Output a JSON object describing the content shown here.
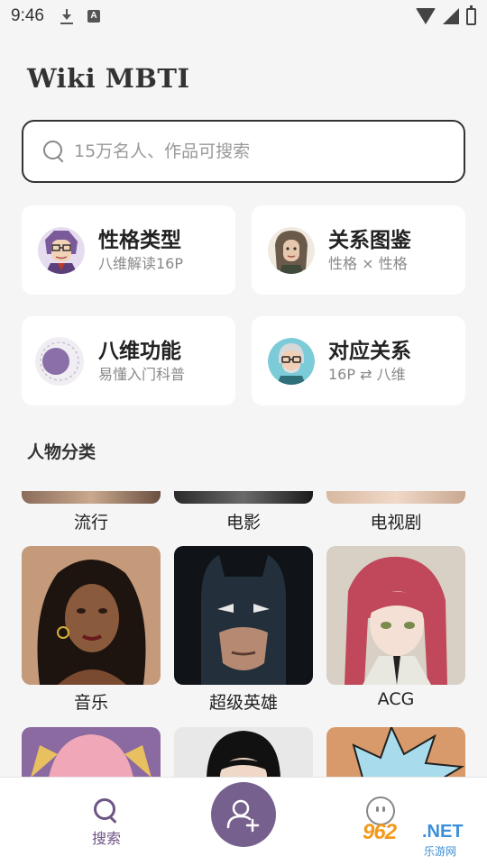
{
  "status_bar": {
    "time": "9:46"
  },
  "app_title": "Wiki MBTI",
  "search": {
    "placeholder": "15万名人、作品可搜索"
  },
  "feature_cards": [
    {
      "title": "性格类型",
      "subtitle": "八维解读16P",
      "icon": "avatar-glasses-woman-icon"
    },
    {
      "title": "关系图鉴",
      "subtitle": "性格 × 性格",
      "icon": "avatar-long-hair-woman-icon"
    },
    {
      "title": "八维功能",
      "subtitle": "易懂入门科普",
      "icon": "purple-circle-icon"
    },
    {
      "title": "对应关系",
      "subtitle": "16P ⇄ 八维",
      "icon": "avatar-old-man-icon"
    }
  ],
  "section_title": "人物分类",
  "categories_row1": [
    "流行",
    "电影",
    "电视剧"
  ],
  "categories_row2": [
    "音乐",
    "超级英雄",
    "ACG"
  ],
  "bottom_nav": {
    "search_label": "搜索"
  },
  "watermark": {
    "num": "962",
    "net": ".NET",
    "cn": "乐游网"
  },
  "colors": {
    "accent": "#76608e",
    "background": "#f5f5f5",
    "card": "#ffffff"
  }
}
